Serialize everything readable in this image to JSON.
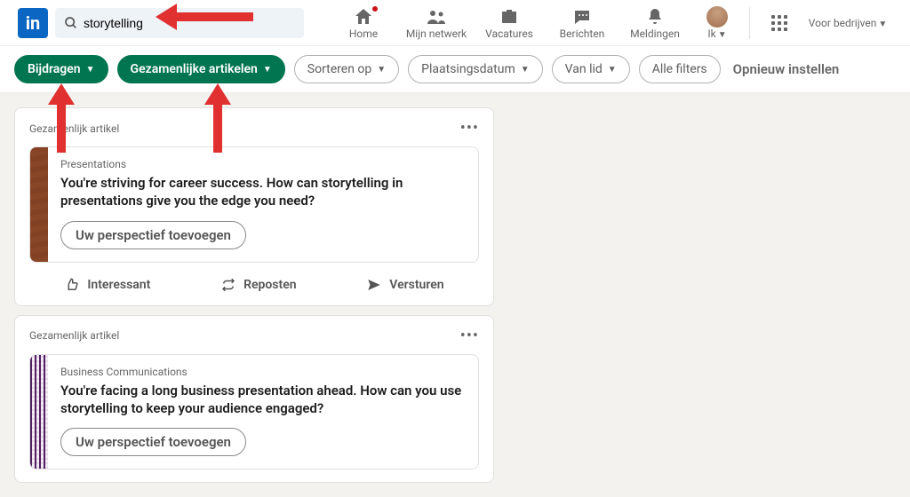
{
  "header": {
    "search_value": "storytelling",
    "nav": {
      "home": "Home",
      "network": "Mijn netwerk",
      "jobs": "Vacatures",
      "messages": "Berichten",
      "notifications": "Meldingen",
      "me": "Ik",
      "business": "Voor bedrijven"
    }
  },
  "filters": {
    "contributions": "Bijdragen",
    "collab_articles": "Gezamenlijke artikelen",
    "sort": "Sorteren op",
    "date": "Plaatsingsdatum",
    "from_member": "Van lid",
    "all": "Alle filters",
    "reset": "Opnieuw instellen"
  },
  "cards": [
    {
      "label": "Gezamenlijk artikel",
      "category": "Presentations",
      "title": "You're striving for career success. How can storytelling in presentations give you the edge you need?",
      "add": "Uw perspectief toevoegen",
      "actions": {
        "like": "Interessant",
        "repost": "Reposten",
        "send": "Versturen"
      }
    },
    {
      "label": "Gezamenlijk artikel",
      "category": "Business Communications",
      "title": "You're facing a long business presentation ahead. How can you use storytelling to keep your audience engaged?",
      "add": "Uw perspectief toevoegen"
    }
  ]
}
